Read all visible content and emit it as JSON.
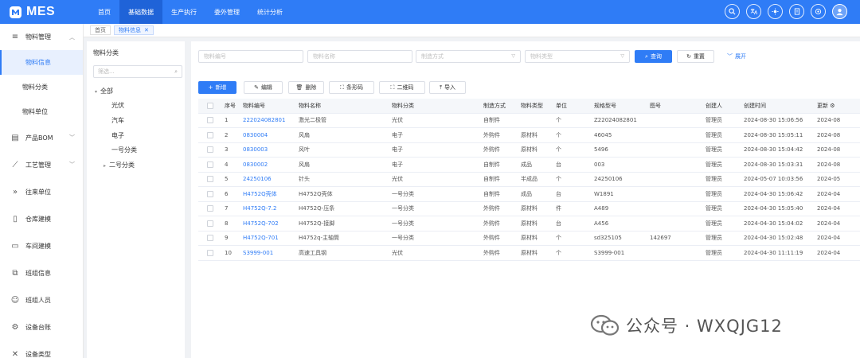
{
  "app": {
    "title": "MES",
    "accent": "#2f7cf6"
  },
  "topnav": [
    {
      "label": "首页",
      "active": false
    },
    {
      "label": "基础数据",
      "active": true
    },
    {
      "label": "生产执行",
      "active": false
    },
    {
      "label": "委外管理",
      "active": false
    },
    {
      "label": "统计分析",
      "active": false
    }
  ],
  "top_icons": [
    "search-icon",
    "translate-icon",
    "theme-icon",
    "document-icon",
    "settings-icon",
    "user-avatar-icon"
  ],
  "sidebar": {
    "group": {
      "label": "物料管理",
      "icon": "menu-icon",
      "expanded": true
    },
    "subitems": [
      {
        "label": "物料信息",
        "active": true
      },
      {
        "label": "物料分类",
        "active": false
      },
      {
        "label": "物料单位",
        "active": false
      }
    ],
    "items": [
      {
        "label": "产品BOM",
        "icon": "database-icon",
        "has_children": true
      },
      {
        "label": "工艺管理",
        "icon": "chart-icon",
        "has_children": true
      },
      {
        "label": "往来单位",
        "icon": "double-chevron-icon",
        "has_children": false
      },
      {
        "label": "仓库建模",
        "icon": "clipboard-icon",
        "has_children": false
      },
      {
        "label": "车间建模",
        "icon": "factory-icon",
        "has_children": false
      },
      {
        "label": "班组信息",
        "icon": "group-icon",
        "has_children": false
      },
      {
        "label": "班组人员",
        "icon": "person-icon",
        "has_children": false
      },
      {
        "label": "设备台账",
        "icon": "device-icon",
        "has_children": false
      },
      {
        "label": "设备类型",
        "icon": "tools-icon",
        "has_children": false
      }
    ]
  },
  "tabs": [
    {
      "label": "首页",
      "active": false,
      "closable": false
    },
    {
      "label": "物料信息",
      "active": true,
      "closable": true
    }
  ],
  "tree": {
    "title": "物料分类",
    "search_placeholder": "筛选...",
    "root": "全部",
    "children": [
      "光伏",
      "汽车",
      "电子",
      "一号分类",
      "二号分类"
    ]
  },
  "filters": {
    "code_placeholder": "物料编号",
    "name_placeholder": "物料名称",
    "method_placeholder": "制造方式",
    "type_placeholder": "物料类型",
    "query_label": "查询",
    "reset_label": "重置",
    "expand_label": "展开"
  },
  "actions": {
    "add": "新增",
    "edit": "编辑",
    "delete": "删除",
    "barcode": "条形码",
    "qrcode": "二维码",
    "import": "导入"
  },
  "table": {
    "columns": [
      "序号",
      "物料编号",
      "物料名称",
      "物料分类",
      "制造方式",
      "物料类型",
      "单位",
      "规格型号",
      "图号",
      "创建人",
      "创建时间",
      "更新"
    ],
    "rows": [
      [
        "1",
        "222024082801",
        "激光二极管",
        "光伏",
        "自制件",
        "",
        "个",
        "Z22024082801",
        "",
        "管理员",
        "2024-08-30 15:06:56",
        "2024-08"
      ],
      [
        "2",
        "0830004",
        "风扇",
        "电子",
        "外购件",
        "原材料",
        "个",
        "46045",
        "",
        "管理员",
        "2024-08-30 15:05:11",
        "2024-08"
      ],
      [
        "3",
        "0830003",
        "风叶",
        "电子",
        "外购件",
        "原材料",
        "个",
        "5496",
        "",
        "管理员",
        "2024-08-30 15:04:42",
        "2024-08"
      ],
      [
        "4",
        "0830002",
        "风扇",
        "电子",
        "自制件",
        "成品",
        "台",
        "003",
        "",
        "管理员",
        "2024-08-30 15:03:31",
        "2024-08"
      ],
      [
        "5",
        "24250106",
        "针头",
        "光伏",
        "自制件",
        "半成品",
        "个",
        "24250106",
        "",
        "管理员",
        "2024-05-07 10:03:56",
        "2024-05"
      ],
      [
        "6",
        "H4752Q壳体",
        "H4752Q壳体",
        "一号分类",
        "自制件",
        "成品",
        "台",
        "W1891",
        "",
        "管理员",
        "2024-04-30 15:06:42",
        "2024-04"
      ],
      [
        "7",
        "H4752Q-7.2",
        "H4752Q-压条",
        "一号分类",
        "外购件",
        "原材料",
        "件",
        "A489",
        "",
        "管理员",
        "2024-04-30 15:05:40",
        "2024-04"
      ],
      [
        "8",
        "H4752Q-702",
        "H4752Q-接脚",
        "一号分类",
        "外购件",
        "原材料",
        "台",
        "A456",
        "",
        "管理员",
        "2024-04-30 15:04:02",
        "2024-04"
      ],
      [
        "9",
        "H4752Q-701",
        "H4752q-主轴筒",
        "一号分类",
        "外购件",
        "原材料",
        "个",
        "sd325105",
        "142697",
        "管理员",
        "2024-04-30 15:02:48",
        "2024-04"
      ],
      [
        "10",
        "S3999-001",
        "高速工具钢",
        "光伏",
        "外购件",
        "原材料",
        "个",
        "S3999-001",
        "",
        "管理员",
        "2024-04-30 11:11:19",
        "2024-04"
      ]
    ]
  },
  "watermark": {
    "text": "公众号 · WXQJG12"
  }
}
